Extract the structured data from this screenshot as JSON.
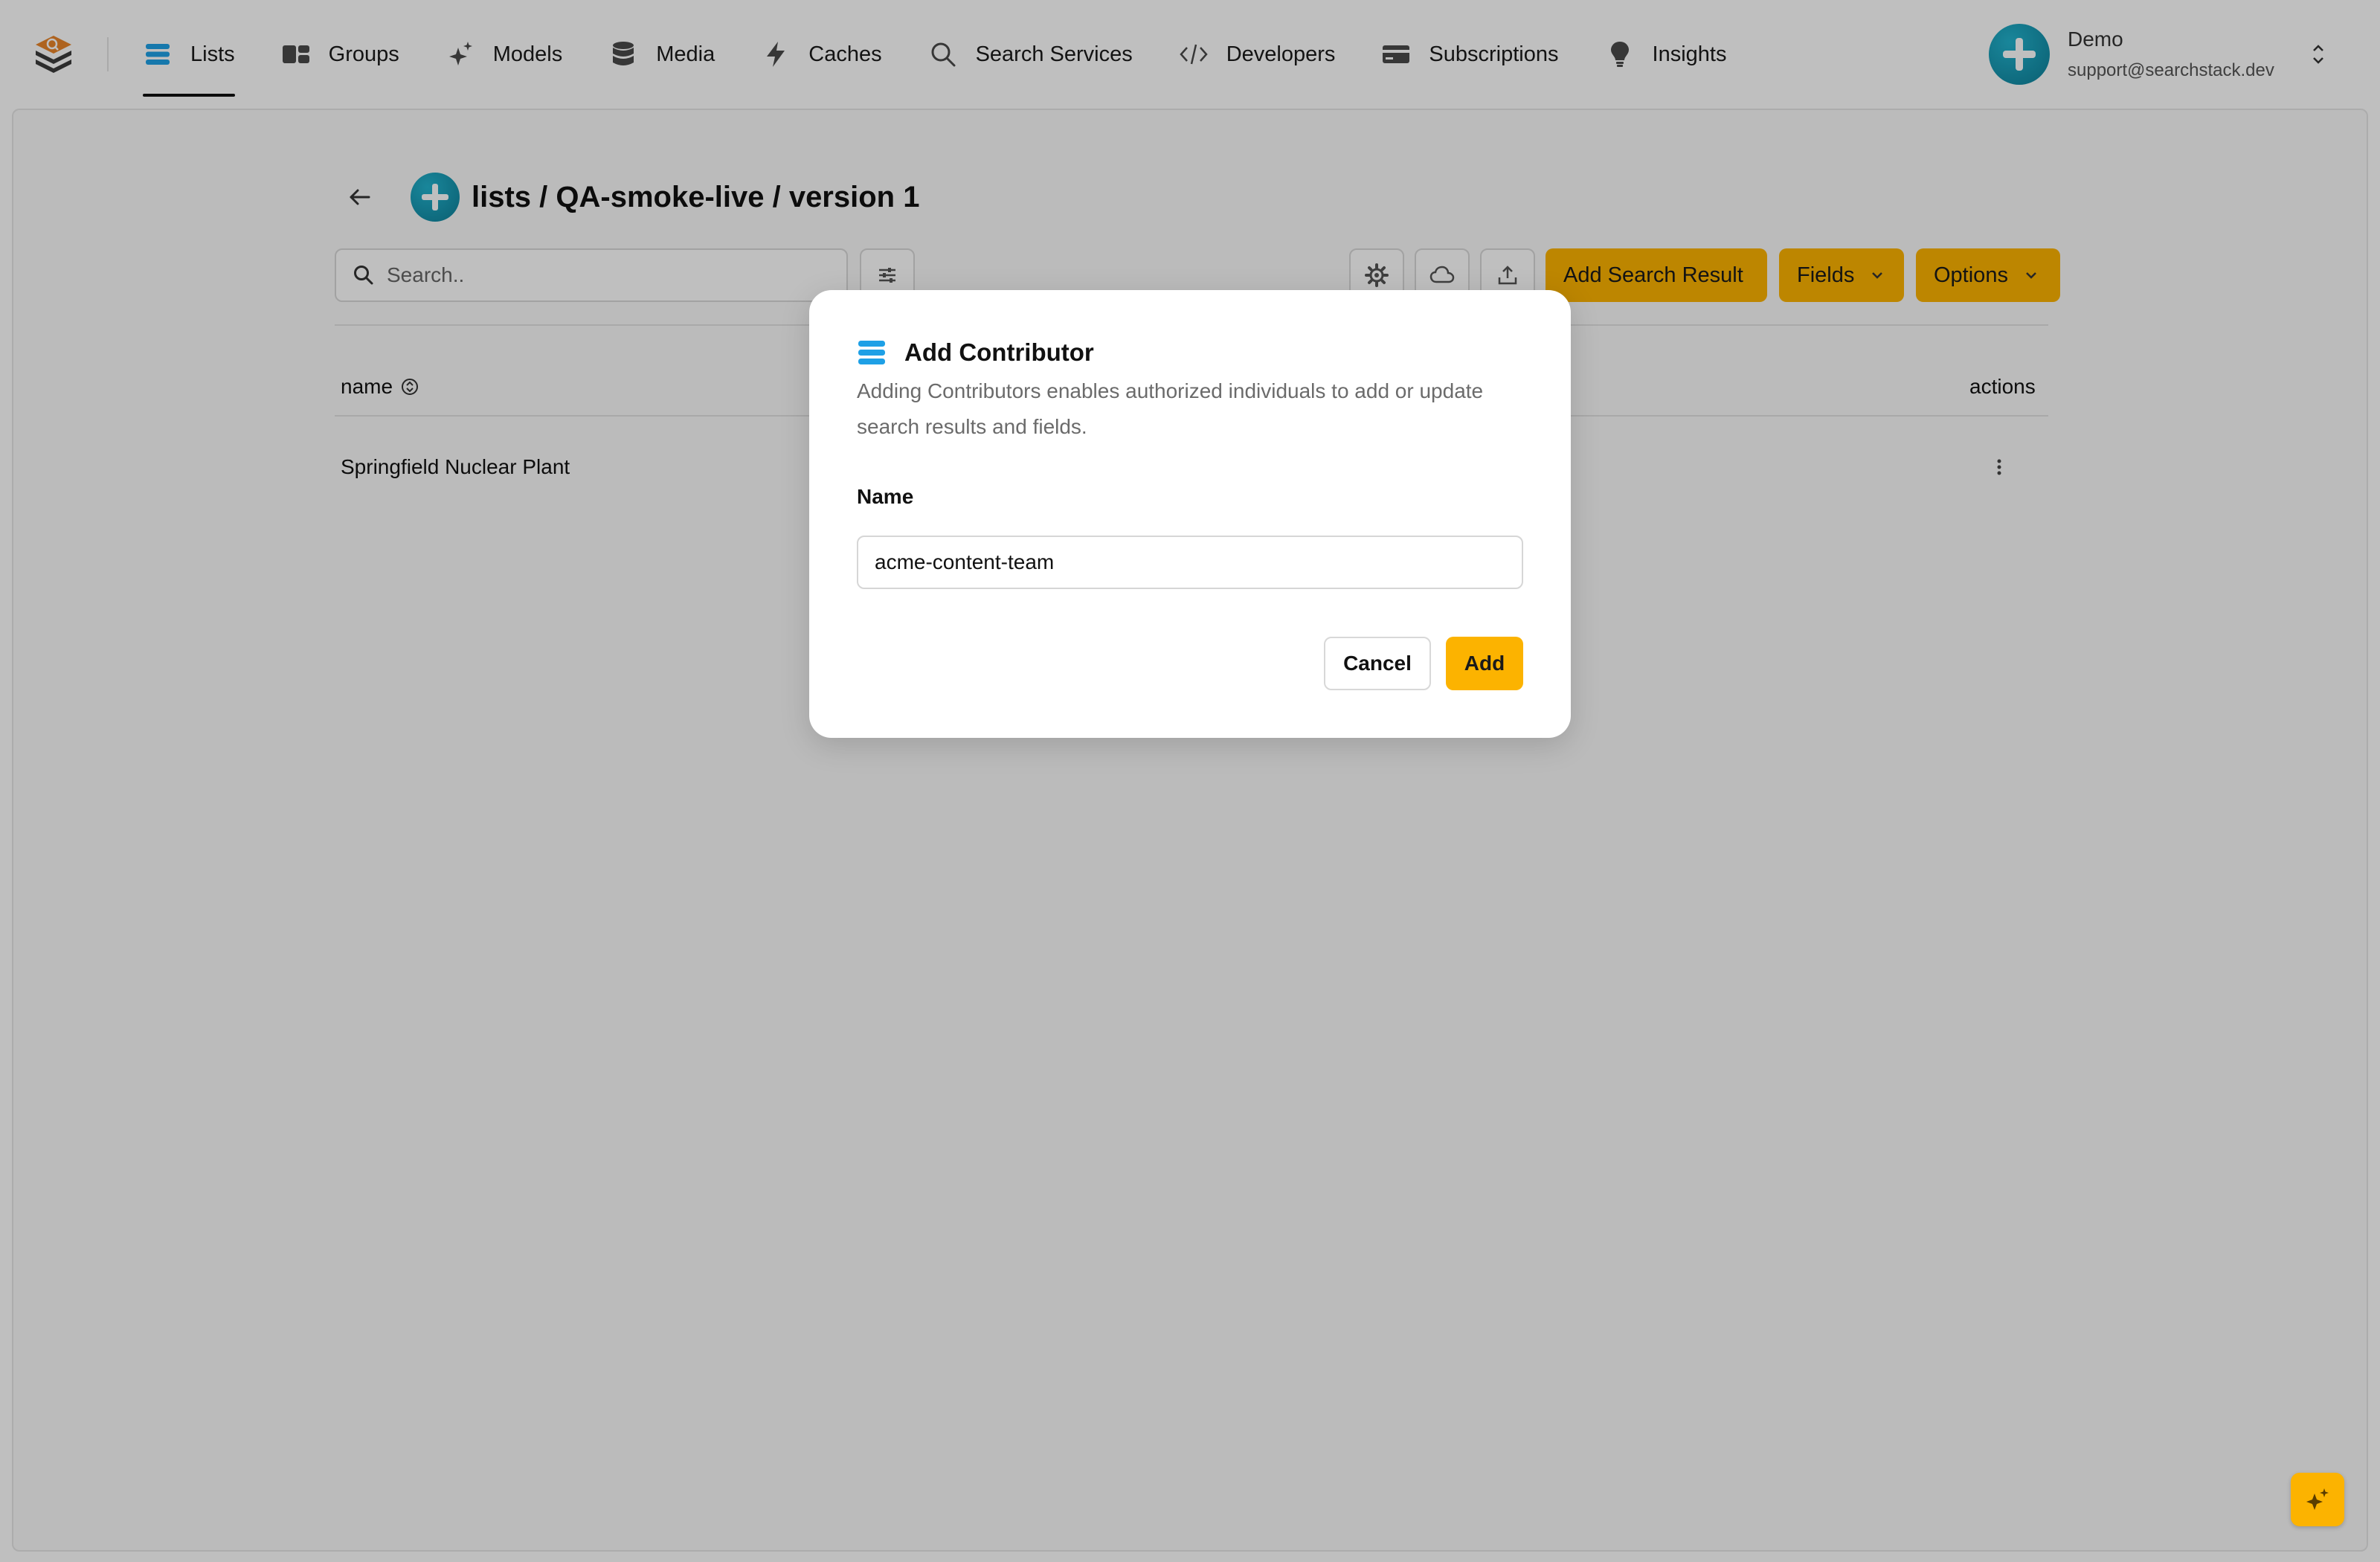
{
  "nav": {
    "logo_icon": "layers-search-logo-icon",
    "items": [
      {
        "label": "Lists",
        "icon": "list-stack-icon",
        "active": true
      },
      {
        "label": "Groups",
        "icon": "groups-icon"
      },
      {
        "label": "Models",
        "icon": "sparkle-icon"
      },
      {
        "label": "Media",
        "icon": "database-icon"
      },
      {
        "label": "Caches",
        "icon": "lightning-icon"
      },
      {
        "label": "Search Services",
        "icon": "search-icon"
      },
      {
        "label": "Developers",
        "icon": "code-icon"
      },
      {
        "label": "Subscriptions",
        "icon": "credit-card-icon"
      },
      {
        "label": "Insights",
        "icon": "lightbulb-icon"
      }
    ]
  },
  "user": {
    "name": "Demo",
    "email": "support@searchstack.dev"
  },
  "page": {
    "title": "lists / QA-smoke-live / version 1"
  },
  "toolbar": {
    "search_placeholder": "Search..",
    "add_search_result_label": "Add Search Result",
    "fields_label": "Fields",
    "options_label": "Options"
  },
  "table": {
    "columns": [
      "name",
      "actions"
    ],
    "rows": [
      {
        "name": "Springfield Nuclear Plant"
      }
    ]
  },
  "modal": {
    "title": "Add Contributor",
    "description": "Adding Contributors enables authorized individuals to add or update search results and fields.",
    "name_label": "Name",
    "name_value": "acme-content-team",
    "cancel_label": "Cancel",
    "add_label": "Add"
  },
  "colors": {
    "accent_yellow": "#fcb300",
    "brand_teal": "#1596b3",
    "list_icon_blue": "#1ea0e6"
  }
}
